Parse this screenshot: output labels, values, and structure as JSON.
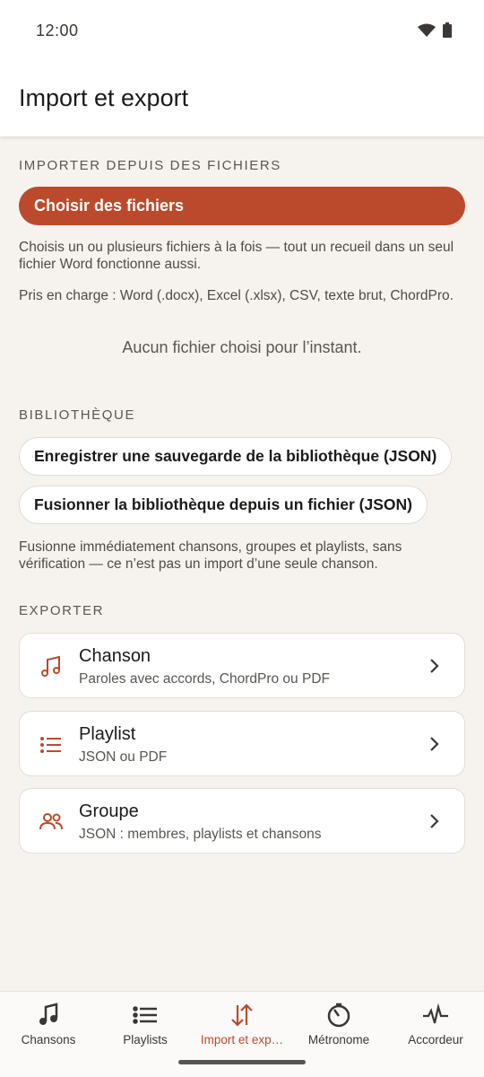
{
  "status_bar": {
    "time": "12:00"
  },
  "header": {
    "title": "Import et export"
  },
  "import_section": {
    "label": "IMPORTER DEPUIS DES FICHIERS",
    "choose_button": "Choisir des fichiers",
    "description": "Choisis un ou plusieurs fichiers à la fois — tout un recueil dans un seul fichier Word fonctionne aussi.",
    "supported_formats": "Pris en charge : Word (.docx), Excel (.xlsx), CSV, texte brut, ChordPro.",
    "empty_state": "Aucun fichier choisi pour l’instant."
  },
  "library_section": {
    "label": "BIBLIOTHÈQUE",
    "save_backup_button": "Enregistrer une sauvegarde de la bibliothèque (JSON)",
    "merge_button": "Fusionner la bibliothèque depuis un fichier (JSON)",
    "note": "Fusionne immédiatement chansons, groupes et playlists, sans vérification — ce n’est pas un import d’une seule chanson."
  },
  "export_section": {
    "label": "EXPORTER",
    "items": [
      {
        "title": "Chanson",
        "subtitle": "Paroles avec accords, ChordPro ou PDF",
        "icon": "music-note-icon"
      },
      {
        "title": "Playlist",
        "subtitle": "JSON ou PDF",
        "icon": "list-icon"
      },
      {
        "title": "Groupe",
        "subtitle": "JSON : membres, playlists et chansons",
        "icon": "people-icon"
      }
    ]
  },
  "bottom_nav": {
    "active_index": 2,
    "items": [
      {
        "label": "Chansons",
        "icon": "music-note-icon"
      },
      {
        "label": "Playlists",
        "icon": "list-icon"
      },
      {
        "label": "Import et exp…",
        "icon": "import-export-icon"
      },
      {
        "label": "Métronome",
        "icon": "metronome-icon"
      },
      {
        "label": "Accordeur",
        "icon": "tuner-icon"
      }
    ]
  },
  "colors": {
    "accent": "#bb4a2c",
    "background": "#f6f3ee",
    "surface": "#ffffff"
  }
}
